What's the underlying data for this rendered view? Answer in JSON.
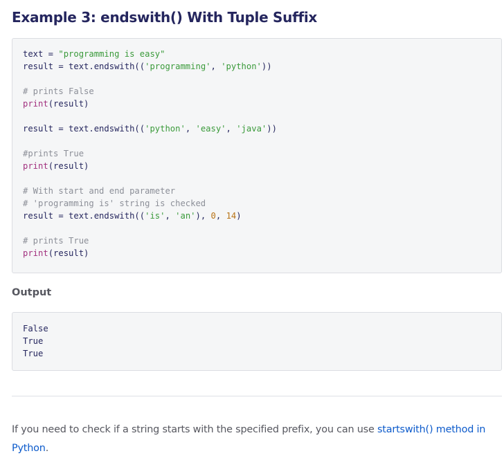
{
  "article": {
    "title": "Example 3: endswith() With Tuple Suffix",
    "code": {
      "line1": {
        "a": "text = ",
        "b": "\"programming is easy\""
      },
      "line2": {
        "a": "result = text.endswith((",
        "b": "'programming'",
        "c": ", ",
        "d": "'python'",
        "e": "))"
      },
      "line4": {
        "a": "# prints False"
      },
      "line5": {
        "a": "print",
        "b": "(result)"
      },
      "line7": {
        "a": "result = text.endswith((",
        "b": "'python'",
        "c": ", ",
        "d": "'easy'",
        "e": ", ",
        "f": "'java'",
        "g": "))"
      },
      "line9": {
        "a": "#prints True"
      },
      "line10": {
        "a": "print",
        "b": "(result)"
      },
      "line12": {
        "a": "# With start and end parameter"
      },
      "line13": {
        "a": "# 'programming is' string is checked"
      },
      "line14": {
        "a": "result = text.endswith((",
        "b": "'is'",
        "c": ", ",
        "d": "'an'",
        "e": "), ",
        "f": "0",
        "g": ", ",
        "h": "14",
        "i": ")"
      },
      "line16": {
        "a": "# prints True"
      },
      "line17": {
        "a": "print",
        "b": "(result)"
      }
    },
    "output_heading": "Output",
    "output_lines": [
      "False",
      "True",
      "True"
    ],
    "paragraph": {
      "text_before": "If you need to check if a string starts with the specified prefix, you can use ",
      "link_text": "startswith() method in Python",
      "text_after": "."
    }
  },
  "colors": {
    "title": "#25265e",
    "string": "#3a9a3a",
    "comment": "#8c8f98",
    "builtin": "#a2317f",
    "number": "#b87316",
    "link": "#0d5bcb",
    "code_background": "#f5f6f7"
  }
}
